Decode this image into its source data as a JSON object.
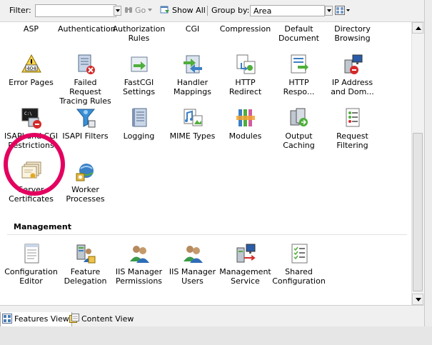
{
  "toolbar": {
    "filter_label": "Filter:",
    "filter_value": "",
    "go_label": "Go",
    "show_all_label": "Show All",
    "group_by_label": "Group by:",
    "group_by_value": "Area"
  },
  "rows": [
    {
      "items": [
        {
          "name": "asp",
          "label": "ASP",
          "icon": "asp-icon"
        },
        {
          "name": "authentication",
          "label": "Authentication",
          "icon": "authentication-icon"
        },
        {
          "name": "authorization-rules",
          "label": "Authorization Rules",
          "icon": "authorization-rules-icon"
        },
        {
          "name": "cgi",
          "label": "CGI",
          "icon": "cgi-icon"
        },
        {
          "name": "compression",
          "label": "Compression",
          "icon": "compression-icon"
        },
        {
          "name": "default-document",
          "label": "Default Document",
          "icon": "default-document-icon"
        },
        {
          "name": "directory-browsing",
          "label": "Directory Browsing",
          "icon": "directory-browsing-icon"
        }
      ]
    },
    {
      "items": [
        {
          "name": "error-pages",
          "label": "Error Pages",
          "icon": "error-pages-icon"
        },
        {
          "name": "failed-request-tracing-rules",
          "label": "Failed Request Tracing Rules",
          "icon": "failed-request-tracing-icon"
        },
        {
          "name": "fastcgi-settings",
          "label": "FastCGI Settings",
          "icon": "fastcgi-icon"
        },
        {
          "name": "handler-mappings",
          "label": "Handler Mappings",
          "icon": "handler-mappings-icon"
        },
        {
          "name": "http-redirect",
          "label": "HTTP Redirect",
          "icon": "http-redirect-icon"
        },
        {
          "name": "http-response-headers",
          "label": "HTTP Respo...",
          "icon": "http-response-headers-icon"
        },
        {
          "name": "ip-address-and-domain",
          "label": "IP Address and Dom...",
          "icon": "ip-address-icon"
        }
      ]
    },
    {
      "items": [
        {
          "name": "isapi-cgi-restrictions",
          "label": "ISAPI and CGI Restrictions",
          "icon": "isapi-cgi-icon"
        },
        {
          "name": "isapi-filters",
          "label": "ISAPI Filters",
          "icon": "isapi-filters-icon"
        },
        {
          "name": "logging",
          "label": "Logging",
          "icon": "logging-icon"
        },
        {
          "name": "mime-types",
          "label": "MIME Types",
          "icon": "mime-types-icon"
        },
        {
          "name": "modules",
          "label": "Modules",
          "icon": "modules-icon"
        },
        {
          "name": "output-caching",
          "label": "Output Caching",
          "icon": "output-caching-icon"
        },
        {
          "name": "request-filtering",
          "label": "Request Filtering",
          "icon": "request-filtering-icon"
        }
      ]
    },
    {
      "items": [
        {
          "name": "server-certificates",
          "label": "Server Certificates",
          "icon": "server-certificates-icon"
        },
        {
          "name": "worker-processes",
          "label": "Worker Processes",
          "icon": "worker-processes-icon"
        }
      ]
    }
  ],
  "management": {
    "title": "Management",
    "items": [
      {
        "name": "configuration-editor",
        "label": "Configuration Editor",
        "icon": "configuration-editor-icon"
      },
      {
        "name": "feature-delegation",
        "label": "Feature Delegation",
        "icon": "feature-delegation-icon"
      },
      {
        "name": "iis-manager-permissions",
        "label": "IIS Manager Permissions",
        "icon": "iis-manager-permissions-icon"
      },
      {
        "name": "iis-manager-users",
        "label": "IIS Manager Users",
        "icon": "iis-manager-users-icon"
      },
      {
        "name": "management-service",
        "label": "Management Service",
        "icon": "management-service-icon"
      },
      {
        "name": "shared-configuration",
        "label": "Shared Configuration",
        "icon": "shared-configuration-icon"
      }
    ]
  },
  "bottom": {
    "features_view_label": "Features View",
    "content_view_label": "Content View",
    "active_tab": "Features View"
  },
  "colors": {
    "highlight_ring": "#e3005f",
    "toolbar_bg": "#f0f0f0"
  }
}
